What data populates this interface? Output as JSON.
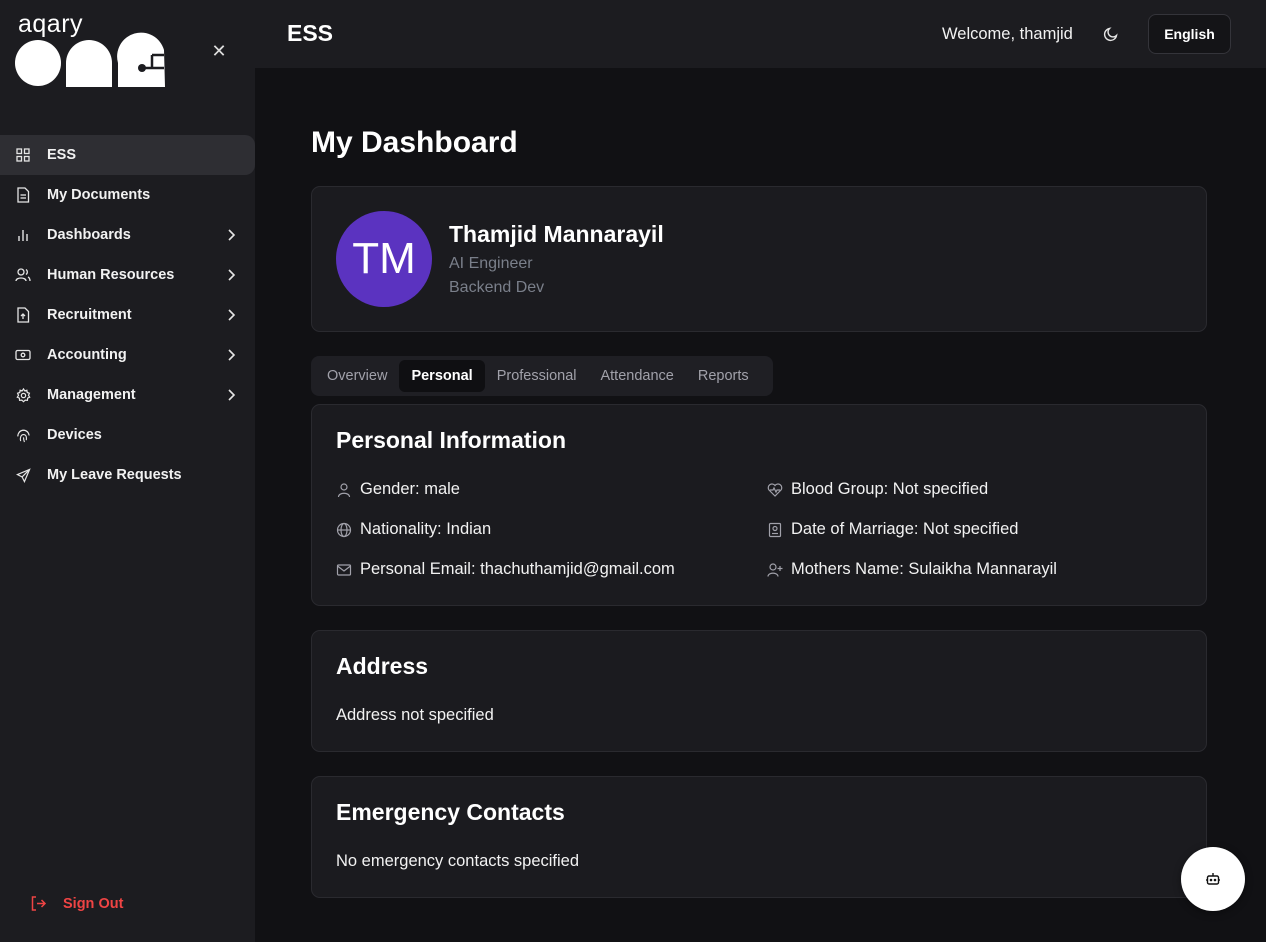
{
  "brand": {
    "logo_top": "aqary",
    "logo_wordmark": "one"
  },
  "sidebar": {
    "items": [
      {
        "label": "ESS",
        "icon": "grid-icon",
        "active": true,
        "has_children": false
      },
      {
        "label": "My Documents",
        "icon": "document-icon",
        "active": false,
        "has_children": false
      },
      {
        "label": "Dashboards",
        "icon": "bar-chart-icon",
        "active": false,
        "has_children": true
      },
      {
        "label": "Human Resources",
        "icon": "users-icon",
        "active": false,
        "has_children": true
      },
      {
        "label": "Recruitment",
        "icon": "file-upload-icon",
        "active": false,
        "has_children": true
      },
      {
        "label": "Accounting",
        "icon": "banknote-icon",
        "active": false,
        "has_children": true
      },
      {
        "label": "Management",
        "icon": "gear-icon",
        "active": false,
        "has_children": true
      },
      {
        "label": "Devices",
        "icon": "fingerprint-icon",
        "active": false,
        "has_children": false
      },
      {
        "label": "My Leave Requests",
        "icon": "plane-icon",
        "active": false,
        "has_children": false
      }
    ],
    "sign_out": "Sign Out"
  },
  "header": {
    "title": "ESS",
    "welcome": "Welcome, thamjid",
    "language": "English"
  },
  "main": {
    "page_title": "My Dashboard",
    "profile": {
      "initials": "TM",
      "name": "Thamjid Mannarayil",
      "role": "AI Engineer",
      "department": "Backend Dev"
    },
    "tabs": [
      {
        "label": "Overview",
        "active": false
      },
      {
        "label": "Personal",
        "active": true
      },
      {
        "label": "Professional",
        "active": false
      },
      {
        "label": "Attendance",
        "active": false
      },
      {
        "label": "Reports",
        "active": false
      }
    ],
    "personal_info": {
      "title": "Personal Information",
      "gender": "Gender: male",
      "nationality": "Nationality: Indian",
      "email": "Personal Email: thachuthamjid@gmail.com",
      "blood_group": "Blood Group: Not specified",
      "date_of_marriage": "Date of Marriage: Not specified",
      "mothers_name": "Mothers Name: Sulaikha Mannarayil"
    },
    "address": {
      "title": "Address",
      "text": "Address not specified"
    },
    "emergency": {
      "title": "Emergency Contacts",
      "text": "No emergency contacts specified"
    }
  },
  "colors": {
    "accent_avatar": "#5b33c0",
    "danger": "#ef4444",
    "background": "#111114",
    "sidebar": "#1c1c20"
  }
}
